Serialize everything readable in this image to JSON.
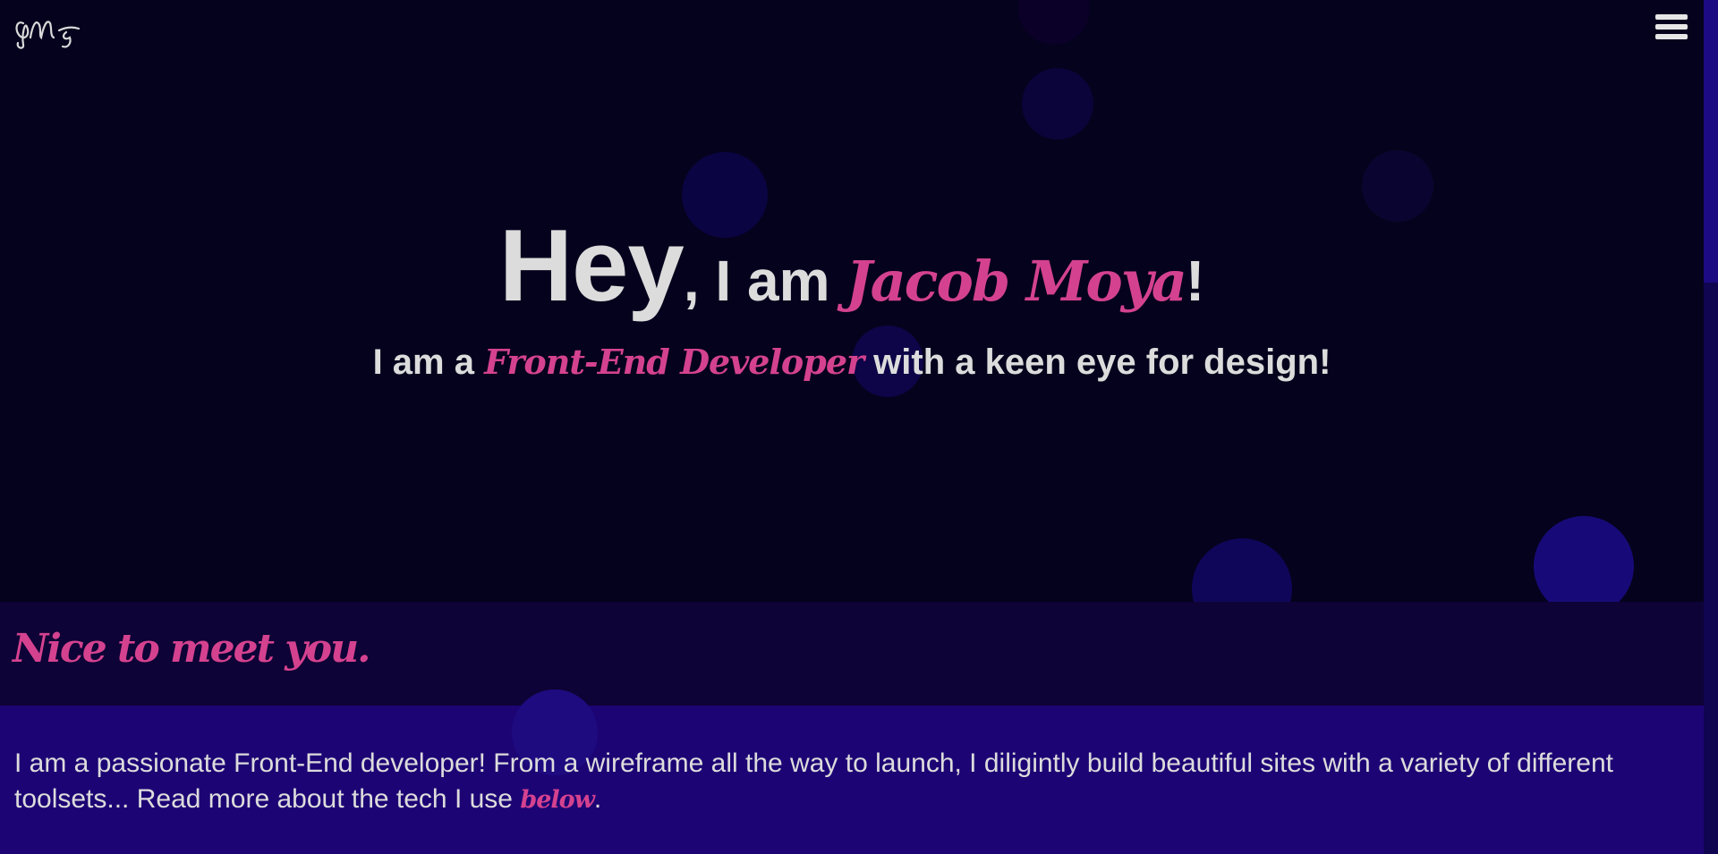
{
  "header": {
    "logo_text": "JMg",
    "menu_icon": "hamburger-menu-icon"
  },
  "hero": {
    "hey": "Hey",
    "comma_iam": ", I am ",
    "name": "Jacob Moya",
    "exclamation": "!",
    "sub_prefix": "I am a ",
    "sub_accent": "Front-End Developer",
    "sub_suffix": " with a keen eye for design!"
  },
  "about": {
    "heading": "Nice to meet you.",
    "text_prefix": "I am a passionate Front-End developer! From a wireframe all the way to launch, I diligintly build beautiful sites with a variety of different toolsets... Read more about the tech I use ",
    "link_text": "below",
    "text_suffix": "."
  },
  "colors": {
    "background": "#05021d",
    "accent": "#d4428f",
    "text": "#dcdcdc",
    "nice_band": "#0e0336",
    "about_band": "#1d0474"
  }
}
